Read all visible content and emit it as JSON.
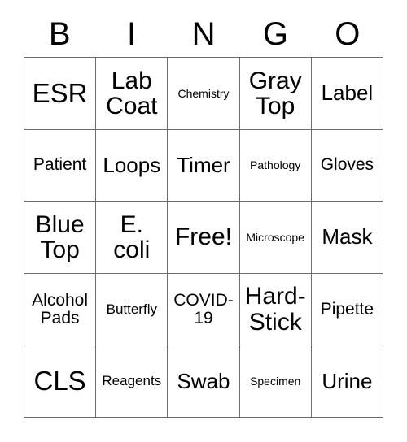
{
  "card": {
    "header_letters": [
      "B",
      "I",
      "N",
      "G",
      "O"
    ],
    "free_space_label": "Free!",
    "border_color": "#6b6b6b",
    "background_color": "#ffffff",
    "text_color": "#000000",
    "grid_size": "5x5",
    "rows": [
      [
        {
          "text": "ESR",
          "size": "xl"
        },
        {
          "text": "Lab Coat",
          "size": "lg"
        },
        {
          "text": "Chemistry",
          "size": "xxs"
        },
        {
          "text": "Gray Top",
          "size": "lg"
        },
        {
          "text": "Label",
          "size": "md"
        }
      ],
      [
        {
          "text": "Patient",
          "size": "sm"
        },
        {
          "text": "Loops",
          "size": "md"
        },
        {
          "text": "Timer",
          "size": "md"
        },
        {
          "text": "Pathology",
          "size": "xxs"
        },
        {
          "text": "Gloves",
          "size": "sm"
        }
      ],
      [
        {
          "text": "Blue Top",
          "size": "lg"
        },
        {
          "text": "E. coli",
          "size": "lg"
        },
        {
          "text": "Free!",
          "size": "lg"
        },
        {
          "text": "Microscope",
          "size": "xxs"
        },
        {
          "text": "Mask",
          "size": "md"
        }
      ],
      [
        {
          "text": "Alcohol Pads",
          "size": "sm"
        },
        {
          "text": "Butterfly",
          "size": "xs"
        },
        {
          "text": "COVID-19",
          "size": "sm"
        },
        {
          "text": "Hard-Stick",
          "size": "lg"
        },
        {
          "text": "Pipette",
          "size": "sm"
        }
      ],
      [
        {
          "text": "CLS",
          "size": "xl"
        },
        {
          "text": "Reagents",
          "size": "xs"
        },
        {
          "text": "Swab",
          "size": "md"
        },
        {
          "text": "Specimen",
          "size": "xxs"
        },
        {
          "text": "Urine",
          "size": "md"
        }
      ]
    ]
  }
}
